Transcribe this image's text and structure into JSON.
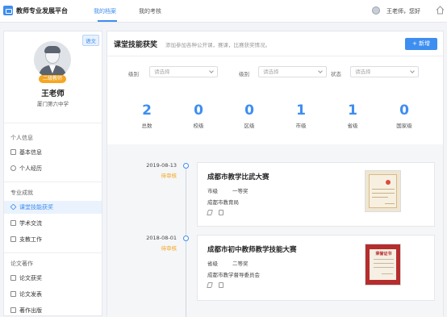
{
  "header": {
    "app_title": "教师专业发展平台",
    "tabs": [
      {
        "label": "我的档案",
        "active": true
      },
      {
        "label": "我的考核",
        "active": false
      }
    ],
    "user_greeting": "王老师，您好",
    "accent_color": "#3d8ef0"
  },
  "profile": {
    "subject_tag": "语文",
    "level_badge": "二级教师",
    "name": "王老师",
    "school": "厦门第六中学"
  },
  "sidebar": {
    "sections": [
      {
        "title": "个人信息",
        "items": [
          {
            "label": "基本信息",
            "icon": "file-icon"
          },
          {
            "label": "个人经历",
            "icon": "person-icon"
          }
        ]
      },
      {
        "title": "专业成就",
        "items": [
          {
            "label": "课堂技能获奖",
            "icon": "award-icon",
            "active": true
          },
          {
            "label": "学术交流",
            "icon": "exchange-icon"
          },
          {
            "label": "支教工作",
            "icon": "support-icon"
          }
        ]
      },
      {
        "title": "论文著作",
        "items": [
          {
            "label": "论文获奖",
            "icon": "paper-award-icon"
          },
          {
            "label": "论文发表",
            "icon": "paper-icon"
          },
          {
            "label": "著作出版",
            "icon": "book-icon"
          }
        ]
      }
    ]
  },
  "main": {
    "title": "课堂技能获奖",
    "hint": "添加参加各种公开课，赛课，比赛获奖情况。",
    "add_label": "+ 新增",
    "filters": [
      {
        "label": "级别",
        "placeholder": "请选择"
      },
      {
        "label": "级别",
        "placeholder": "请选择"
      },
      {
        "label": "状态",
        "placeholder": "请选择"
      }
    ],
    "stats": [
      {
        "value": "2",
        "label": "总数"
      },
      {
        "value": "0",
        "label": "校级"
      },
      {
        "value": "0",
        "label": "区级"
      },
      {
        "value": "1",
        "label": "市级"
      },
      {
        "value": "1",
        "label": "省级"
      },
      {
        "value": "0",
        "label": "国家级"
      }
    ],
    "records": [
      {
        "date": "2019-08-13",
        "status": "待审核",
        "title": "成都市教学比武大赛",
        "level": "市级",
        "prize": "一等奖",
        "org": "成都市教育局"
      },
      {
        "date": "2018-08-01",
        "status": "待审核",
        "title": "成都市初中教师教学技能大赛",
        "level": "省级",
        "prize": "二等奖",
        "org": "成都市教学督导委员会",
        "cert_heading": "荣誉证书"
      }
    ]
  }
}
